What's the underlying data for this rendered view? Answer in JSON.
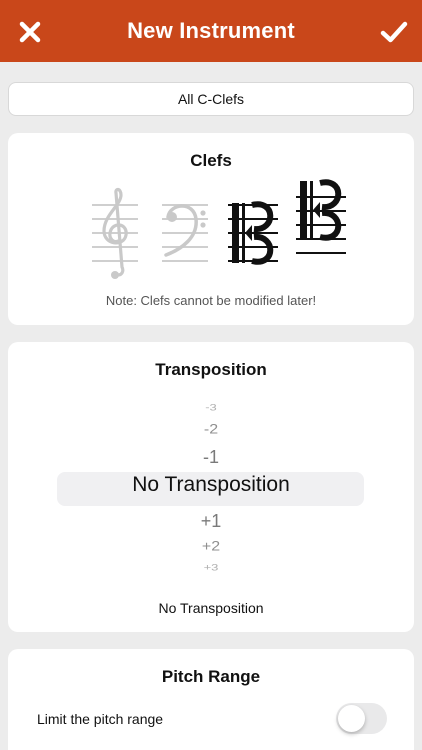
{
  "navbar": {
    "title": "New Instrument",
    "close_icon": "close-x-icon",
    "confirm_icon": "checkmark-icon",
    "background": "#c9471a"
  },
  "preset": {
    "label": "All C-Clefs"
  },
  "clefs": {
    "title": "Clefs",
    "items": [
      {
        "name": "treble-clef",
        "selected": false
      },
      {
        "name": "bass-clef",
        "selected": false
      },
      {
        "name": "alto-clef",
        "selected": true
      },
      {
        "name": "tenor-clef",
        "selected": true
      }
    ],
    "note": "Note: Clefs cannot be modified later!"
  },
  "transposition": {
    "title": "Transposition",
    "picker": {
      "above": [
        "-3",
        "-2",
        "-1"
      ],
      "selected": "No Transposition",
      "below": [
        "+1",
        "+2",
        "+3"
      ]
    },
    "value": "No Transposition"
  },
  "pitch_range": {
    "title": "Pitch Range",
    "limit_label": "Limit the pitch range",
    "limit_enabled": false
  }
}
